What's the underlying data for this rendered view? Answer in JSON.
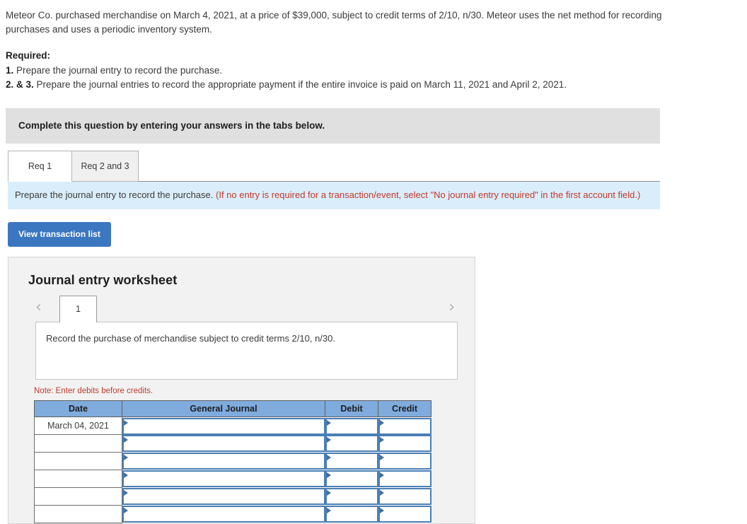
{
  "problem": {
    "statement": "Meteor Co. purchased merchandise on March 4, 2021, at a price of $39,000, subject to credit terms of 2/10, n/30. Meteor uses the net method for recording purchases and uses a periodic inventory system.",
    "required_label": "Required:",
    "requirements": [
      {
        "number": "1.",
        "text": " Prepare the journal entry to record the purchase."
      },
      {
        "number": "2. & 3.",
        "text": " Prepare the journal entries to record the appropriate payment if the entire invoice is paid on March 11, 2021 and April 2, 2021."
      }
    ]
  },
  "banner": {
    "text": "Complete this question by entering your answers in the tabs below."
  },
  "tabs": [
    {
      "label": "Req 1",
      "active": true
    },
    {
      "label": "Req 2 and 3",
      "active": false
    }
  ],
  "instruction": {
    "main": "Prepare the journal entry to record the purchase. ",
    "hint": "(If no entry is required for a transaction/event, select \"No journal entry required\" in the first account field.)"
  },
  "toolbar": {
    "view_transaction_list_label": "View transaction list"
  },
  "worksheet": {
    "title": "Journal entry worksheet",
    "prev_icon": "chevron-left-icon",
    "next_icon": "chevron-right-icon",
    "page_tabs": [
      "1"
    ],
    "description": "Record the purchase of merchandise subject to credit terms 2/10, n/30.",
    "note": "Note: Enter debits before credits.",
    "table": {
      "headers": [
        "Date",
        "General Journal",
        "Debit",
        "Credit"
      ],
      "rows": [
        {
          "date": "March 04, 2021",
          "general_journal": "",
          "debit": "",
          "credit": ""
        },
        {
          "date": "",
          "general_journal": "",
          "debit": "",
          "credit": ""
        },
        {
          "date": "",
          "general_journal": "",
          "debit": "",
          "credit": ""
        },
        {
          "date": "",
          "general_journal": "",
          "debit": "",
          "credit": ""
        },
        {
          "date": "",
          "general_journal": "",
          "debit": "",
          "credit": ""
        },
        {
          "date": "",
          "general_journal": "",
          "debit": "",
          "credit": ""
        }
      ]
    }
  },
  "colors": {
    "button_blue": "#3b76c0",
    "band_blue": "#daedfa",
    "banner_gray": "#e0e0e0",
    "table_header_blue": "#7fabdd",
    "input_border_blue": "#4b7fb5",
    "red_text": "#c0392b"
  }
}
